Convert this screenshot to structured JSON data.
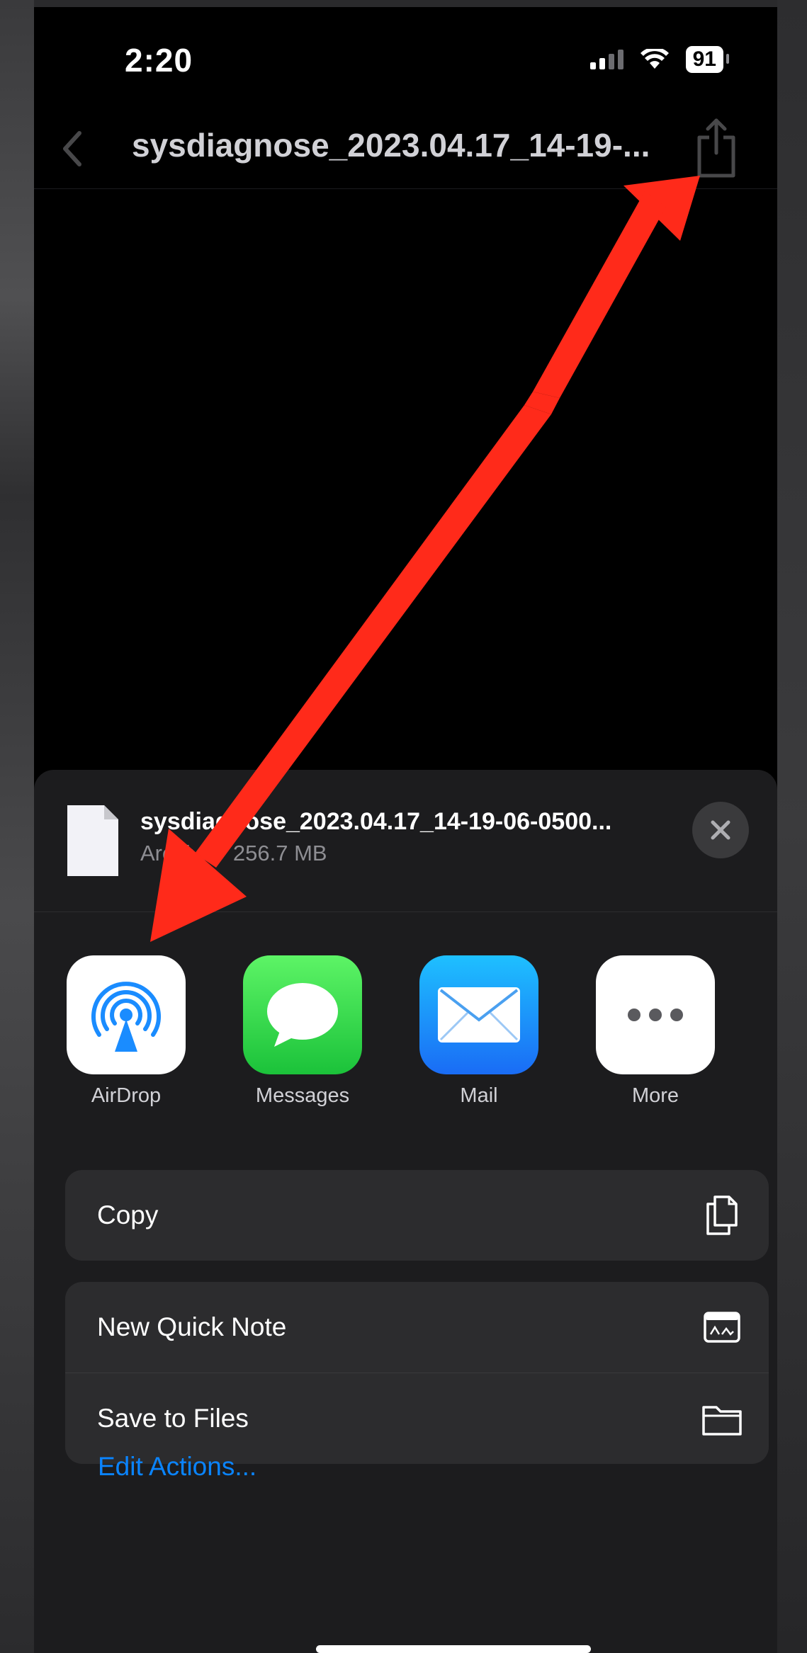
{
  "status_bar": {
    "time": "2:20",
    "battery": "91"
  },
  "nav": {
    "title": "sysdiagnose_2023.04.17_14-19-..."
  },
  "sheet": {
    "file_name": "sysdiagnose_2023.04.17_14-19-06-0500...",
    "file_meta": "Archive · 256.7 MB",
    "apps": [
      {
        "label": "AirDrop",
        "icon": "airdrop-icon"
      },
      {
        "label": "Messages",
        "icon": "messages-icon"
      },
      {
        "label": "Mail",
        "icon": "mail-icon"
      },
      {
        "label": "More",
        "icon": "more-icon"
      }
    ],
    "actions": {
      "copy": "Copy",
      "new_quick_note": "New Quick Note",
      "save_to_files": "Save to Files"
    },
    "edit_actions": "Edit Actions..."
  },
  "colors": {
    "accent": "#0a84ff",
    "annotation_arrow": "#ff2a1a",
    "sheet_bg": "#1c1c1e",
    "row_bg": "#2c2c2e"
  }
}
